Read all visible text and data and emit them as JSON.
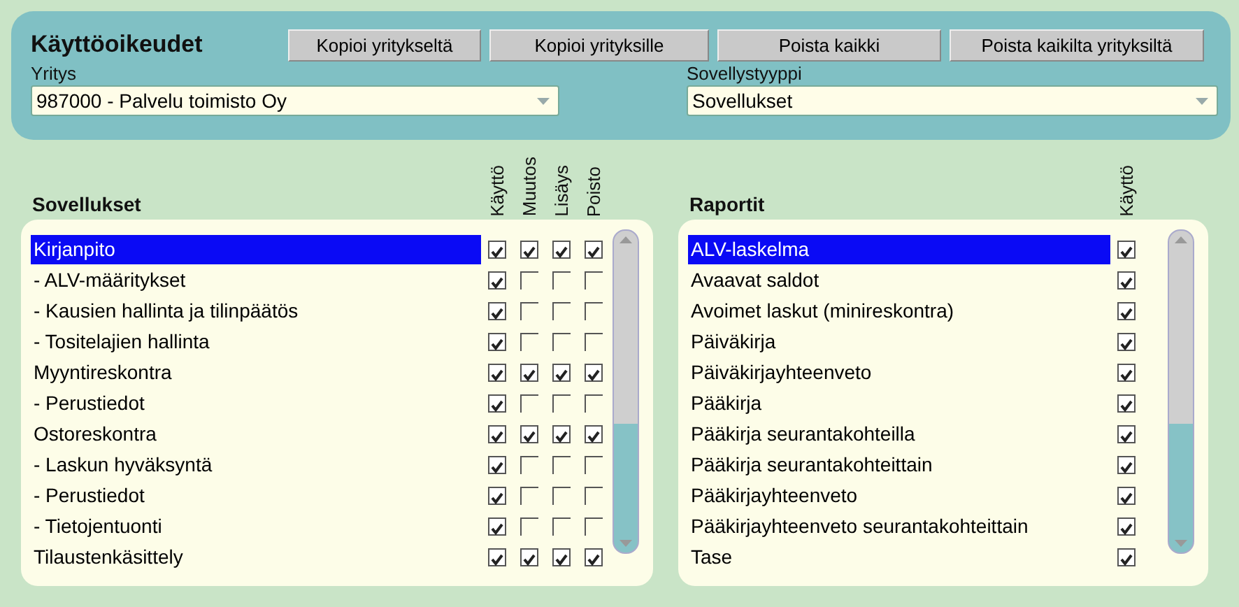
{
  "window": {
    "title": "Käyttöoikeudet"
  },
  "buttons": [
    "Kopioi yritykseltä",
    "Kopioi yrityksille",
    "Poista kaikki",
    "Poista kaikilta yrityksiltä"
  ],
  "fields": [
    {
      "label": "Yritys",
      "value": "987000 - Palvelu toimisto Oy"
    },
    {
      "label": "Sovellystyyppi",
      "value": "Sovellukset"
    }
  ],
  "applications": {
    "title": "Sovellukset",
    "columns": [
      "Käyttö",
      "Muutos",
      "Lisäys",
      "Poisto"
    ],
    "rows": [
      {
        "name": "Kirjanpito",
        "selected": true,
        "checks": [
          true,
          true,
          true,
          true
        ]
      },
      {
        "name": "- ALV-määritykset",
        "selected": false,
        "checks": [
          true,
          false,
          false,
          false
        ]
      },
      {
        "name": "- Kausien hallinta ja tilinpäätös",
        "selected": false,
        "checks": [
          true,
          false,
          false,
          false
        ]
      },
      {
        "name": "- Tositelajien hallinta",
        "selected": false,
        "checks": [
          true,
          false,
          false,
          false
        ]
      },
      {
        "name": "Myyntireskontra",
        "selected": false,
        "checks": [
          true,
          true,
          true,
          true
        ]
      },
      {
        "name": "- Perustiedot",
        "selected": false,
        "checks": [
          true,
          false,
          false,
          false
        ]
      },
      {
        "name": "Ostoreskontra",
        "selected": false,
        "checks": [
          true,
          true,
          true,
          true
        ]
      },
      {
        "name": "- Laskun hyväksyntä",
        "selected": false,
        "checks": [
          true,
          false,
          false,
          false
        ]
      },
      {
        "name": "- Perustiedot",
        "selected": false,
        "checks": [
          true,
          false,
          false,
          false
        ]
      },
      {
        "name": "- Tietojentuonti",
        "selected": false,
        "checks": [
          true,
          false,
          false,
          false
        ]
      },
      {
        "name": "Tilaustenkäsittely",
        "selected": false,
        "checks": [
          true,
          true,
          true,
          true
        ]
      }
    ]
  },
  "reports": {
    "title": "Raportit",
    "columns": [
      "Käyttö"
    ],
    "rows": [
      {
        "name": "ALV-laskelma",
        "selected": true,
        "checks": [
          true
        ]
      },
      {
        "name": "Avaavat saldot",
        "selected": false,
        "checks": [
          true
        ]
      },
      {
        "name": "Avoimet laskut (minireskontra)",
        "selected": false,
        "checks": [
          true
        ]
      },
      {
        "name": "Päiväkirja",
        "selected": false,
        "checks": [
          true
        ]
      },
      {
        "name": "Päiväkirjayhteenveto",
        "selected": false,
        "checks": [
          true
        ]
      },
      {
        "name": "Pääkirja",
        "selected": false,
        "checks": [
          true
        ]
      },
      {
        "name": "Pääkirja seurantakohteilla",
        "selected": false,
        "checks": [
          true
        ]
      },
      {
        "name": "Pääkirja seurantakohteittain",
        "selected": false,
        "checks": [
          true
        ]
      },
      {
        "name": "Pääkirjayhteenveto",
        "selected": false,
        "checks": [
          true
        ]
      },
      {
        "name": "Pääkirjayhteenveto seurantakohteittain",
        "selected": false,
        "checks": [
          true
        ]
      },
      {
        "name": "Tase",
        "selected": false,
        "checks": [
          true
        ]
      }
    ]
  }
}
